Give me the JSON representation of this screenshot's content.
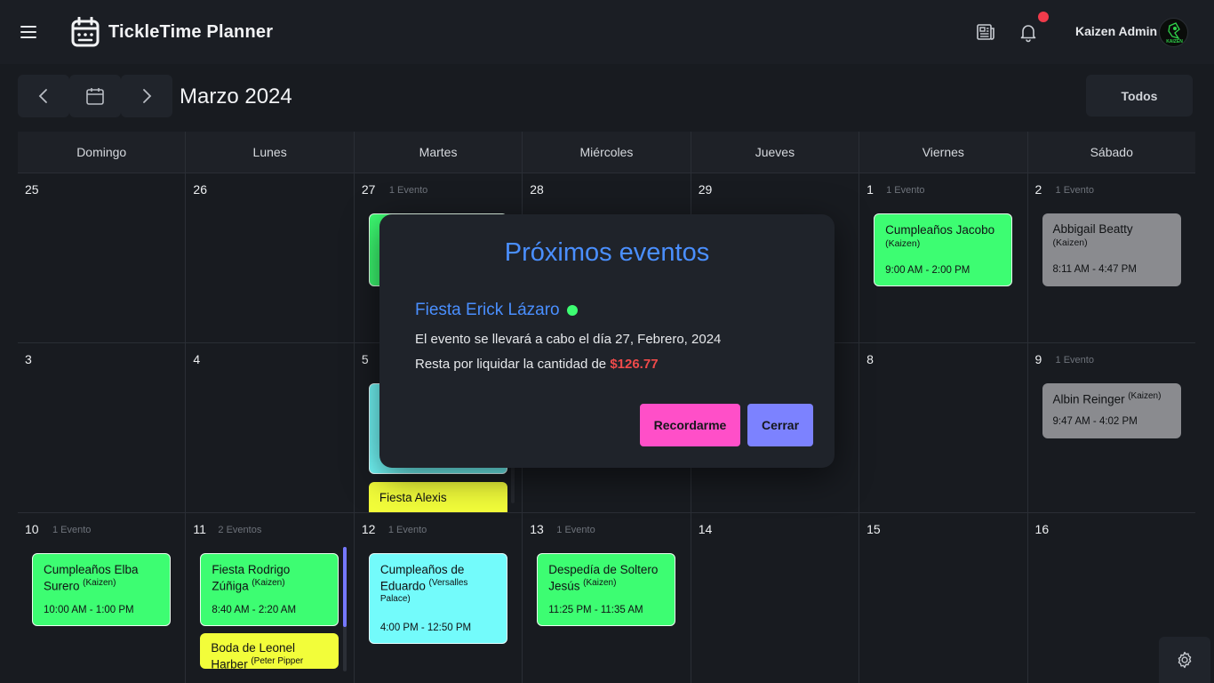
{
  "app": {
    "title": "TickleTime Planner"
  },
  "header": {
    "user_name": "Kaizen Admin",
    "avatar_text": "KAIZEN"
  },
  "toolbar": {
    "month_title": "Marzo 2024",
    "filter_label": "Todos"
  },
  "calendar": {
    "weekdays": [
      "Domingo",
      "Lunes",
      "Martes",
      "Miércoles",
      "Jueves",
      "Viernes",
      "Sábado"
    ],
    "weeks": [
      {
        "days": [
          {
            "num": "25",
            "count": ""
          },
          {
            "num": "26",
            "count": ""
          },
          {
            "num": "27",
            "count": "1 Evento"
          },
          {
            "num": "28",
            "count": ""
          },
          {
            "num": "29",
            "count": ""
          },
          {
            "num": "1",
            "count": "1 Evento",
            "event": {
              "name": "Cumpleaños Jacobo",
              "sub": "(Kaizen)",
              "time": "9:00 AM - 2:00 PM"
            }
          },
          {
            "num": "2",
            "count": "1 Evento",
            "event": {
              "name": "Abbigail Beatty",
              "sub": "(Kaizen)",
              "time": "8:11 AM - 4:47 PM"
            }
          }
        ]
      },
      {
        "days": [
          {
            "num": "3",
            "count": ""
          },
          {
            "num": "4",
            "count": ""
          },
          {
            "num": "5",
            "count": "",
            "event2": {
              "name": "Fiesta Alexis"
            }
          },
          {
            "num": "",
            "count": ""
          },
          {
            "num": "",
            "count": ""
          },
          {
            "num": "8",
            "count": ""
          },
          {
            "num": "9",
            "count": "1 Evento",
            "event": {
              "name": "Albin Reinger",
              "sub": "(Kaizen)",
              "time": "9:47 AM - 4:02 PM"
            }
          }
        ]
      },
      {
        "days": [
          {
            "num": "10",
            "count": "1 Evento",
            "event": {
              "name": "Cumpleaños Elba Surero",
              "sub": "(Kaizen)",
              "time": "10:00 AM - 1:00 PM"
            }
          },
          {
            "num": "11",
            "count": "2 Eventos",
            "event": {
              "name": "Fiesta Rodrigo Zúñiga",
              "sub": "(Kaizen)",
              "time": "8:40 AM - 2:20 AM"
            },
            "event2": {
              "name": "Boda de Leonel Harber",
              "sub": "(Peter Pipper"
            }
          },
          {
            "num": "12",
            "count": "1 Evento",
            "event": {
              "name": "Cumpleaños de Eduardo",
              "sub": "(Versalles Palace)",
              "time": "4:00 PM - 12:50 PM"
            }
          },
          {
            "num": "13",
            "count": "1 Evento",
            "event": {
              "name": "Despedía de Soltero Jesús",
              "sub": "(Kaizen)",
              "time": "11:25 PM - 11:35 AM"
            }
          },
          {
            "num": "14",
            "count": ""
          },
          {
            "num": "15",
            "count": ""
          },
          {
            "num": "16",
            "count": ""
          }
        ]
      }
    ]
  },
  "modal": {
    "title": "Próximos eventos",
    "event_name": "Fiesta Erick Lázaro",
    "line1": "El evento se llevará a cabo el día 27, Febrero, 2024",
    "line2_prefix": "Resta por liquidar la cantidad de",
    "amount": "$126.77",
    "remind_label": "Recordarme",
    "close_label": "Cerrar"
  },
  "colors": {
    "accent_blue": "#4a8fff",
    "event_green": "#3dfd72",
    "event_cyan": "#73fbfb",
    "event_yellow": "#f2fd3a",
    "event_gray": "#8a8b8f",
    "remind_pink": "#ff4fc8",
    "close_violet": "#7c82ff",
    "amount_red": "#ef4a4a"
  }
}
